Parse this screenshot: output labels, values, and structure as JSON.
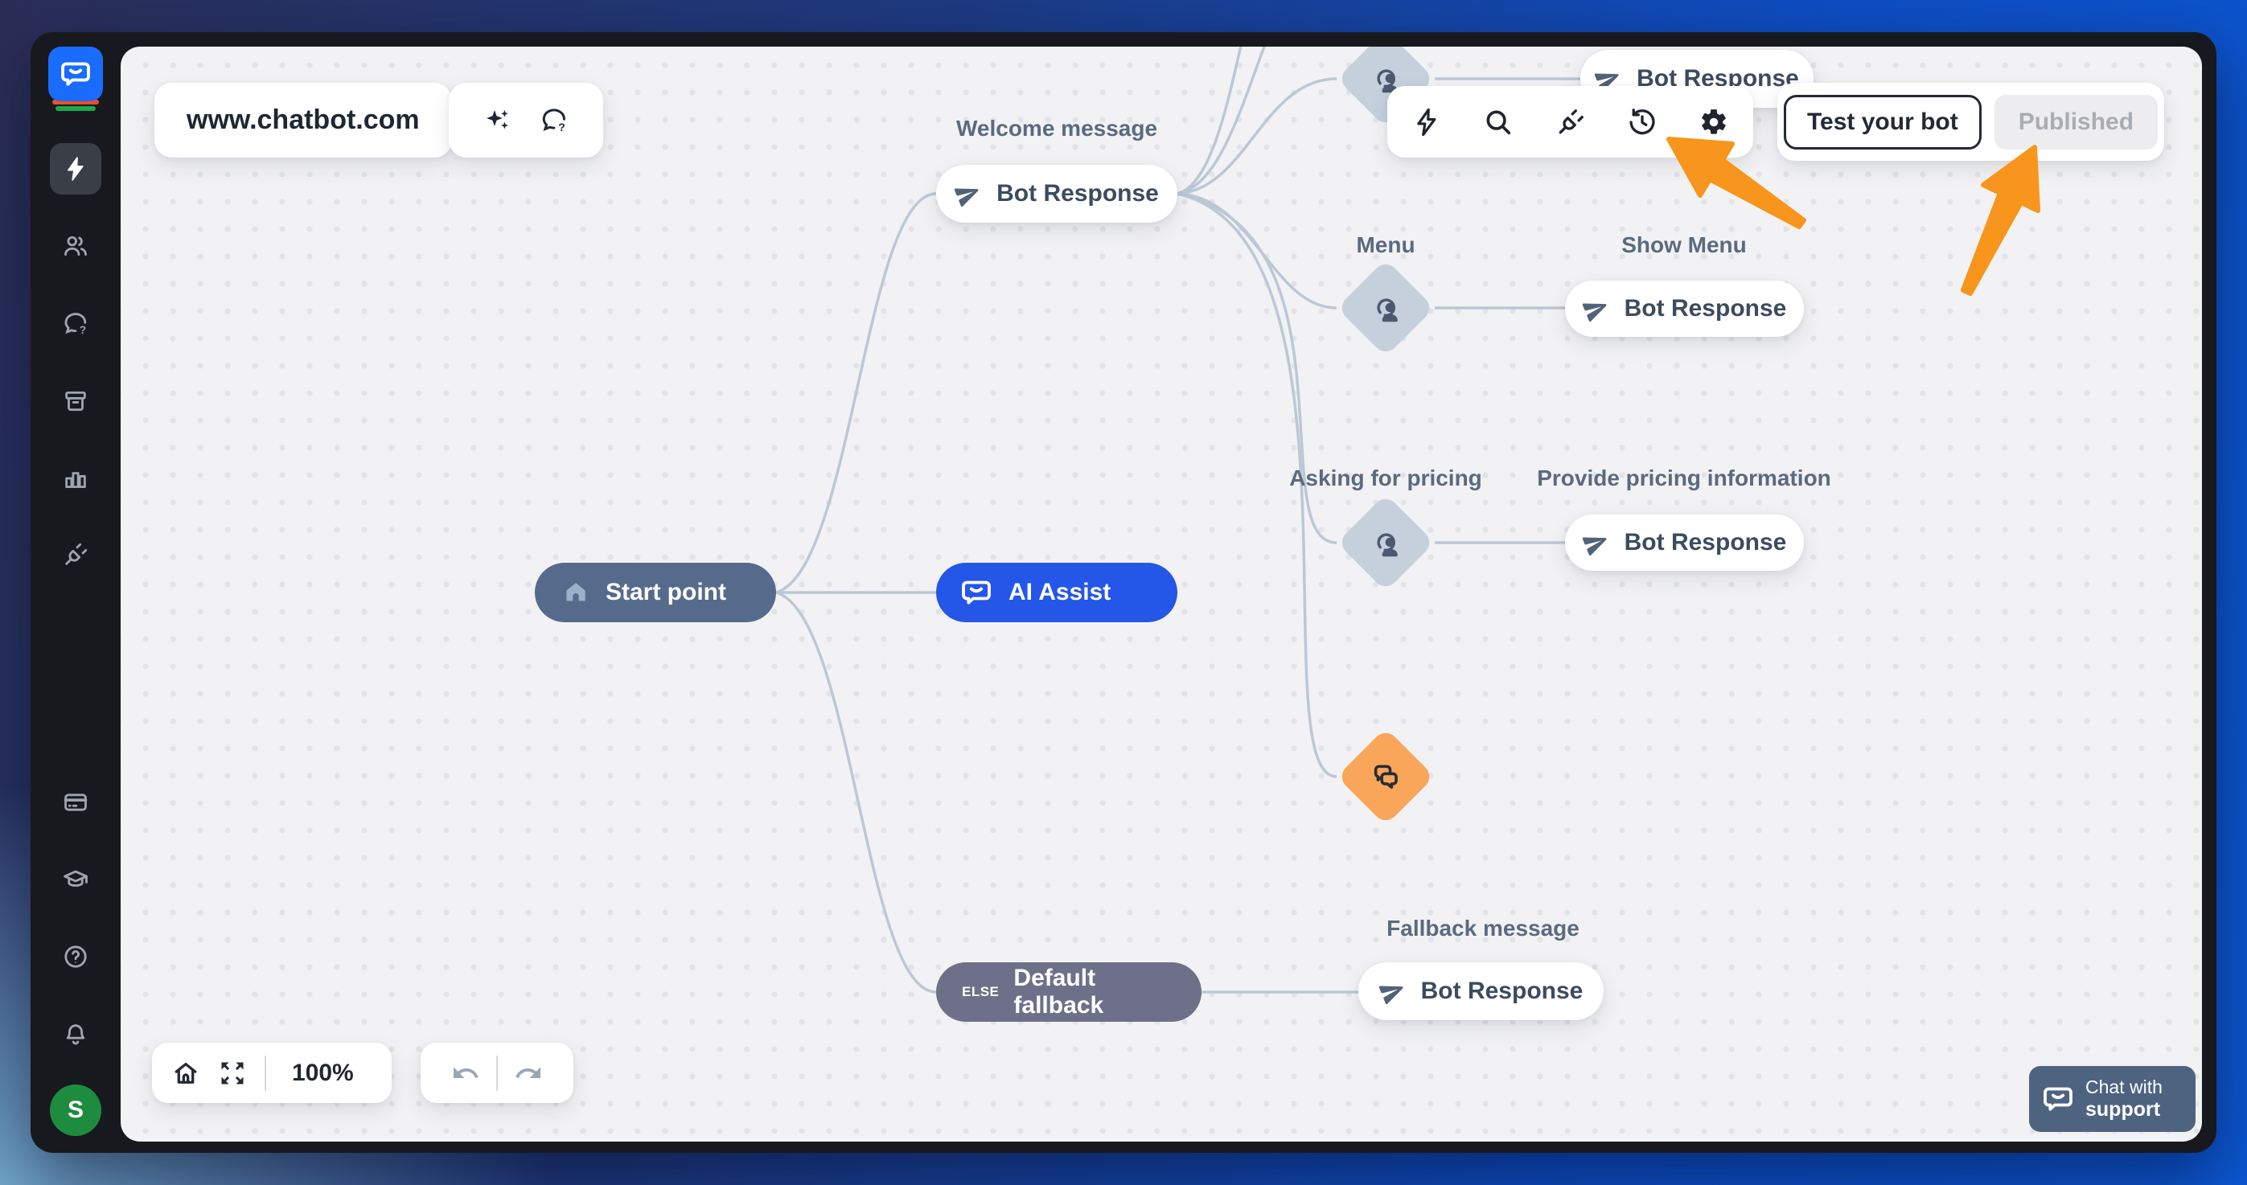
{
  "header": {
    "site_url": "www.chatbot.com"
  },
  "toolbar": {
    "icons": [
      "flash",
      "search",
      "integrations",
      "version-history",
      "settings"
    ]
  },
  "actions": {
    "test_button_label": "Test your bot",
    "published_label": "Published"
  },
  "flow": {
    "start": {
      "label": "Start point"
    },
    "welcome": {
      "caption": "Welcome message",
      "label": "Bot Response"
    },
    "ai_assist": {
      "label": "AI Assist"
    },
    "default_fallback": {
      "badge": "ELSE",
      "label": "Default fallback"
    },
    "fallback_response": {
      "caption": "Fallback message",
      "label": "Bot Response"
    },
    "top_response": {
      "label": "Bot Response"
    },
    "menu": {
      "caption": "Menu",
      "response_caption": "Show Menu",
      "response_label": "Bot Response"
    },
    "pricing": {
      "caption": "Asking for pricing",
      "response_caption": "Provide pricing information",
      "response_label": "Bot Response"
    }
  },
  "controls": {
    "zoom_level": "100%"
  },
  "support": {
    "line1": "Chat with",
    "line2": "support"
  },
  "user": {
    "avatar_initial": "S"
  },
  "colors": {
    "accent_blue": "#2456e8",
    "brand_blue": "#1a6cff",
    "arrow_orange": "#f8951d",
    "node_orange": "#f9a65a",
    "start_slate": "#566b8c",
    "fallback_gray": "#6d7088",
    "diamond_gray": "#c6d0dd",
    "connector": "#bcc7d6",
    "avatar_green": "#1e8c3e"
  }
}
